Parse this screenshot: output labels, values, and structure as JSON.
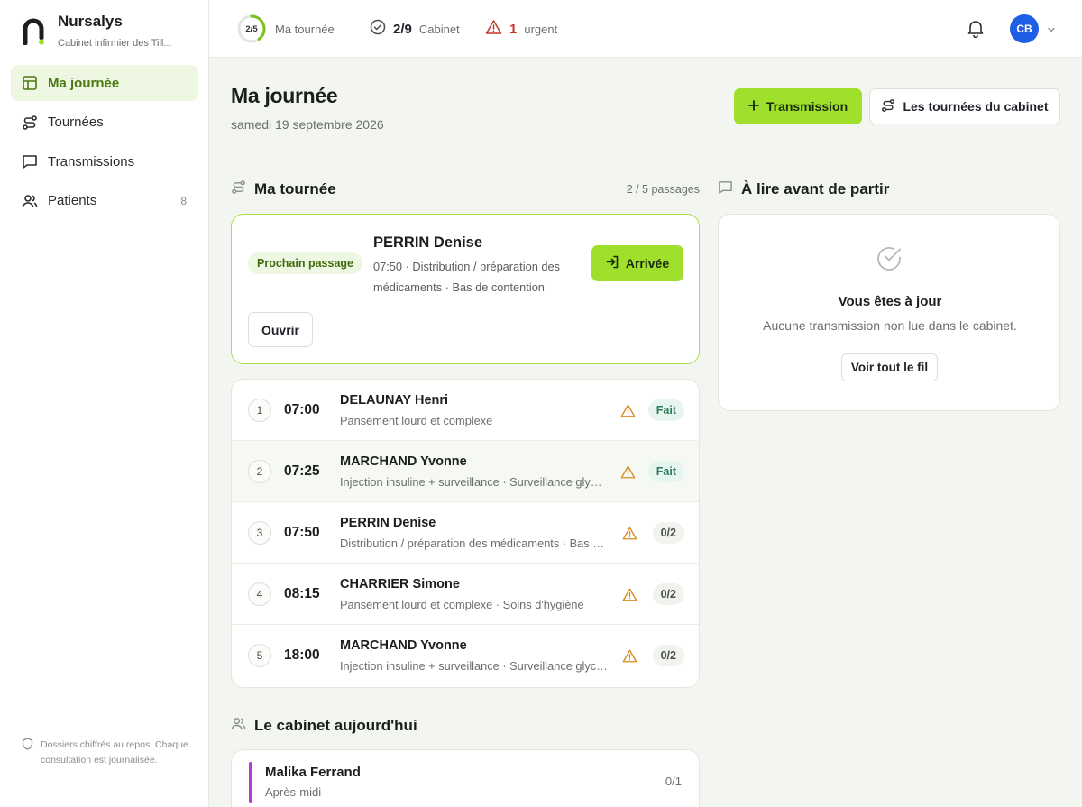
{
  "app": {
    "name": "Nursalys",
    "subtitle": "Cabinet infirmier des Till..."
  },
  "sidebar": {
    "items": [
      {
        "label": "Ma journée",
        "icon": "layout-icon",
        "active": true
      },
      {
        "label": "Tournées",
        "icon": "route-icon"
      },
      {
        "label": "Transmissions",
        "icon": "message-icon"
      },
      {
        "label": "Patients",
        "icon": "users-icon",
        "count": "8"
      }
    ],
    "footer": "Dossiers chiffrés au repos. Chaque consultation est journalisée."
  },
  "topbar": {
    "progress_text": "2/5",
    "progress_value": 0.4,
    "progress_label": "Ma tournée",
    "cabinet_value": "2/9",
    "cabinet_label": "Cabinet",
    "urgent_value": "1",
    "urgent_label": "urgent",
    "avatar_initials": "CB"
  },
  "header": {
    "title": "Ma journée",
    "date": "samedi 19 septembre 2026",
    "primary_button": "Transmission",
    "secondary_button": "Les tournées du cabinet"
  },
  "tour": {
    "title": "Ma tournée",
    "passages": "2 / 5 passages",
    "next": {
      "badge": "Prochain passage",
      "name": "PERRIN Denise",
      "desc": "07:50 · Distribution / préparation des médicaments · Bas de contention",
      "arrive_label": "Arrivée",
      "open_label": "Ouvrir"
    },
    "rows": [
      {
        "num": "1",
        "time": "07:00",
        "name": "DELAUNAY Henri",
        "desc": "Pansement lourd et complexe",
        "status": "Fait",
        "status_type": "done"
      },
      {
        "num": "2",
        "time": "07:25",
        "name": "MARCHAND Yvonne",
        "desc": "Injection insuline + surveillance · Surveillance glycémique",
        "status": "Fait",
        "status_type": "done"
      },
      {
        "num": "3",
        "time": "07:50",
        "name": "PERRIN Denise",
        "desc": "Distribution / préparation des médicaments · Bas de contention",
        "status": "0/2",
        "status_type": "pending"
      },
      {
        "num": "4",
        "time": "08:15",
        "name": "CHARRIER Simone",
        "desc": "Pansement lourd et complexe · Soins d'hygiène",
        "status": "0/2",
        "status_type": "pending"
      },
      {
        "num": "5",
        "time": "18:00",
        "name": "MARCHAND Yvonne",
        "desc": "Injection insuline + surveillance · Surveillance glycémique",
        "status": "0/2",
        "status_type": "pending"
      }
    ]
  },
  "cabinet": {
    "title": "Le cabinet aujourd'hui",
    "members": [
      {
        "name": "Malika Ferrand",
        "shift": "Après-midi",
        "count": "0/1",
        "color": "#b23bd0"
      }
    ]
  },
  "read": {
    "title": "À lire avant de partir",
    "empty_title": "Vous êtes à jour",
    "empty_sub": "Aucune transmission non lue dans le cabinet.",
    "button": "Voir tout le fil"
  },
  "colors": {
    "accent": "#9ee02c",
    "accent_text": "#4c7a12",
    "urgent": "#c0392b",
    "avatar": "#1f5fe6",
    "warn": "#d98b1f"
  }
}
